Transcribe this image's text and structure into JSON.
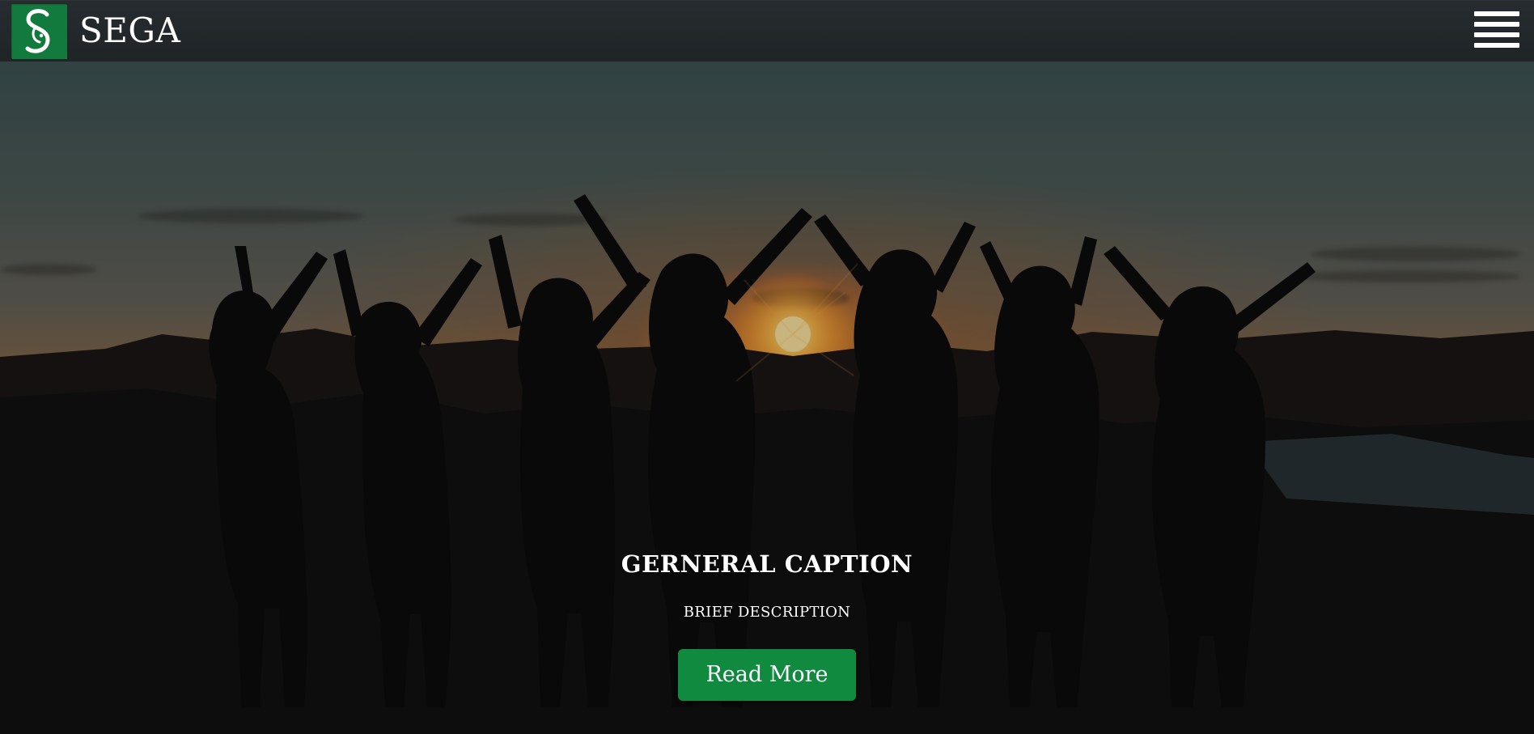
{
  "header": {
    "brand": "SEGA",
    "logo_letter": "S",
    "menu_icon": "hamburger-menu-icon"
  },
  "hero": {
    "caption": "GERNERAL CAPTION",
    "description": "BRIEF DESCRIPTION",
    "button_label": "Read More"
  },
  "colors": {
    "header_bg": "#262c2f",
    "brand_green": "#117a3c",
    "button_green": "#0f8a3f",
    "text": "#ffffff"
  }
}
